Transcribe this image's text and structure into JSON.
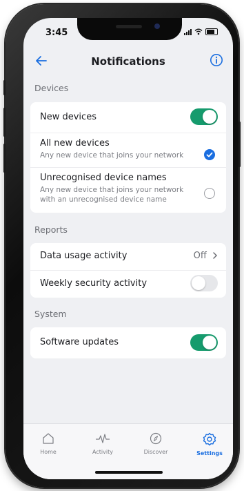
{
  "status": {
    "time": "3:45"
  },
  "header": {
    "title": "Notifications",
    "back_icon": "back-arrow-icon",
    "info_icon": "info-icon"
  },
  "sections": {
    "devices": "Devices",
    "reports": "Reports",
    "system": "System"
  },
  "devices": {
    "new_devices": {
      "label": "New devices",
      "on": true
    },
    "all_new": {
      "label": "All new devices",
      "sub": "Any new device that joins your network",
      "selected": true
    },
    "unrecognised": {
      "label": "Unrecognised device names",
      "sub1": "Any new device that joins your network",
      "sub2": "with an unrecognised device name",
      "selected": false
    }
  },
  "reports": {
    "data_usage": {
      "label": "Data usage activity",
      "value": "Off"
    },
    "weekly_security": {
      "label": "Weekly security activity",
      "on": false
    }
  },
  "system": {
    "software_updates": {
      "label": "Software updates",
      "on": true
    }
  },
  "tabs": [
    {
      "label": "Home",
      "icon": "home-icon",
      "active": false
    },
    {
      "label": "Activity",
      "icon": "activity-icon",
      "active": false
    },
    {
      "label": "Discover",
      "icon": "compass-icon",
      "active": false
    },
    {
      "label": "Settings",
      "icon": "gear-icon",
      "active": true
    }
  ],
  "colors": {
    "accent": "#1a6ee0",
    "toggle_on": "#169b6d",
    "background": "#eff0f3"
  }
}
